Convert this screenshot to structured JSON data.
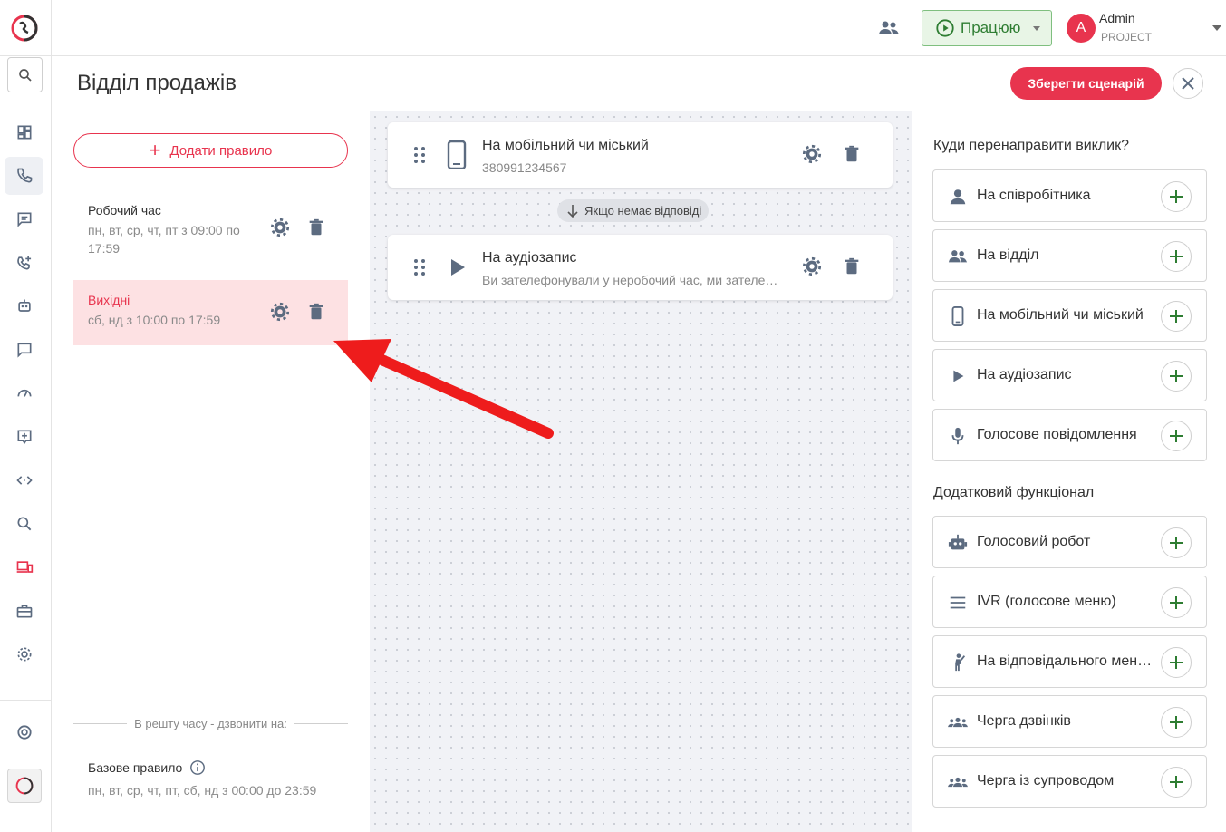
{
  "header": {
    "status_label": "Працюю",
    "user_name": "Admin",
    "user_initial": "A",
    "user_project": "PROJECT"
  },
  "page": {
    "title": "Відділ продажів",
    "save_label": "Зберегти сценарій"
  },
  "rules": {
    "add_label": "Додати правило",
    "items": [
      {
        "name": "Робочий час",
        "desc": "пн, вт, ср, чт, пт з 09:00 по 17:59"
      },
      {
        "name": "Вихідні",
        "desc": "сб, нд з 10:00 по 17:59",
        "selected": true
      }
    ],
    "rest_label": "В решту часу - дзвонити на:",
    "base": {
      "name": "Базове правило",
      "desc": "пн, вт, ср, чт, пт, сб, нд з 00:00 до 23:59"
    }
  },
  "scenario": {
    "steps": [
      {
        "title": "На мобільний чи міський",
        "sub": "380991234567",
        "icon": "phone-icon"
      },
      {
        "title": "На аудіозапис",
        "sub": "Ви зателефонували у неробочий час, ми зателефонуємо вам пізніше",
        "icon": "play-icon"
      }
    ],
    "connector_label": "Якщо немає відповіді"
  },
  "targets": {
    "title": "Куди перенаправити виклик?",
    "items": [
      {
        "label": "На співробітника",
        "icon": "person-icon"
      },
      {
        "label": "На відділ",
        "icon": "group-icon"
      },
      {
        "label": "На мобільний чи міський",
        "icon": "phone-icon"
      },
      {
        "label": "На аудіозапис",
        "icon": "play-icon"
      },
      {
        "label": "Голосове повідомлення",
        "icon": "mic-icon"
      }
    ]
  },
  "extra": {
    "title": "Додатковий функціонал",
    "items": [
      {
        "label": "Голосовий робот",
        "icon": "robot-icon"
      },
      {
        "label": "IVR (голосове меню)",
        "icon": "menu-icon"
      },
      {
        "label": "На відповідального менеджера",
        "icon": "manager-icon"
      },
      {
        "label": "Черга дзвінків",
        "icon": "queue-icon"
      },
      {
        "label": "Черга із супроводом",
        "icon": "queue-escort-icon"
      }
    ]
  },
  "colors": {
    "accent": "#e8344e",
    "success": "#2e7d32",
    "icon": "#5c6b80"
  }
}
